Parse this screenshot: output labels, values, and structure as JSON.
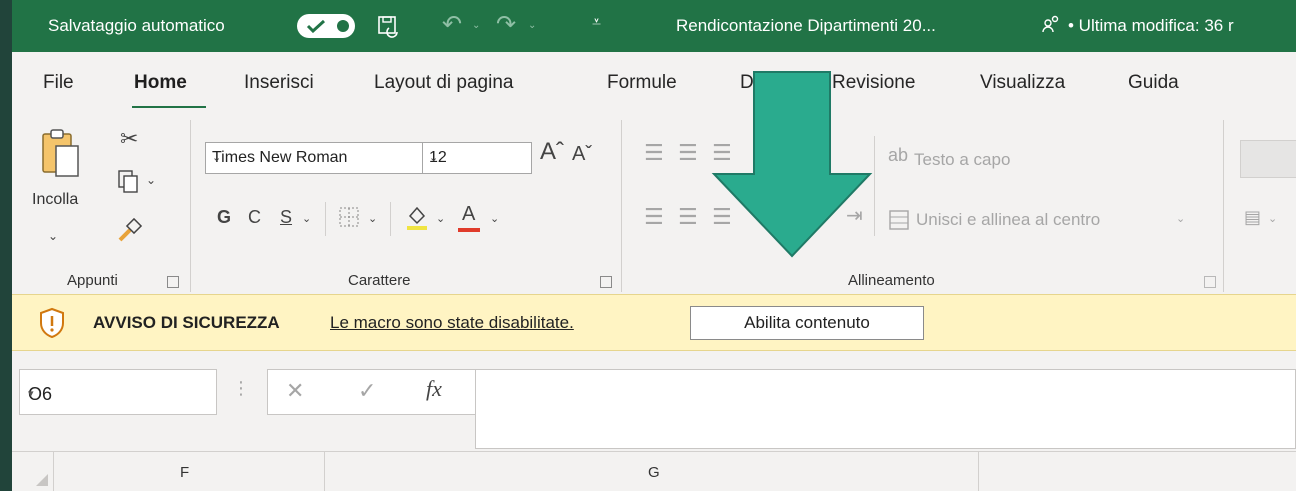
{
  "titlebar": {
    "autosave_label": "Salvataggio automatico",
    "document_title": "Rendicontazione Dipartimenti 20...",
    "last_modified": "• Ultima modifica: 36 r"
  },
  "tabs": [
    {
      "label": "File"
    },
    {
      "label": "Home"
    },
    {
      "label": "Inserisci"
    },
    {
      "label": "Layout di pagina"
    },
    {
      "label": "Formule"
    },
    {
      "label": "D"
    },
    {
      "label": "Revisione"
    },
    {
      "label": "Visualizza"
    },
    {
      "label": "Guida"
    }
  ],
  "ribbon": {
    "clipboard": {
      "paste_label": "Incolla",
      "group_label": "Appunti"
    },
    "font": {
      "font_name": "Times New Roman",
      "font_size": "12",
      "bold": "G",
      "italic": "C",
      "underline": "S",
      "font_color_letter": "A",
      "group_label": "Carattere"
    },
    "alignment": {
      "wrap_text": "Testo a capo",
      "merge_center": "Unisci e allinea al centro",
      "group_label": "Allineamento"
    }
  },
  "security_bar": {
    "title": "AVVISO DI SICUREZZA",
    "message": "Le macro sono state disabilitate.",
    "button": "Abilita contenuto"
  },
  "formula_bar": {
    "name_box": "O6",
    "fx": "fx",
    "value": ""
  },
  "columns": [
    "F",
    "G"
  ],
  "colors": {
    "excel_green": "#217346",
    "arrow_teal": "#2aab8e",
    "security_yellow": "#fff4c3"
  }
}
